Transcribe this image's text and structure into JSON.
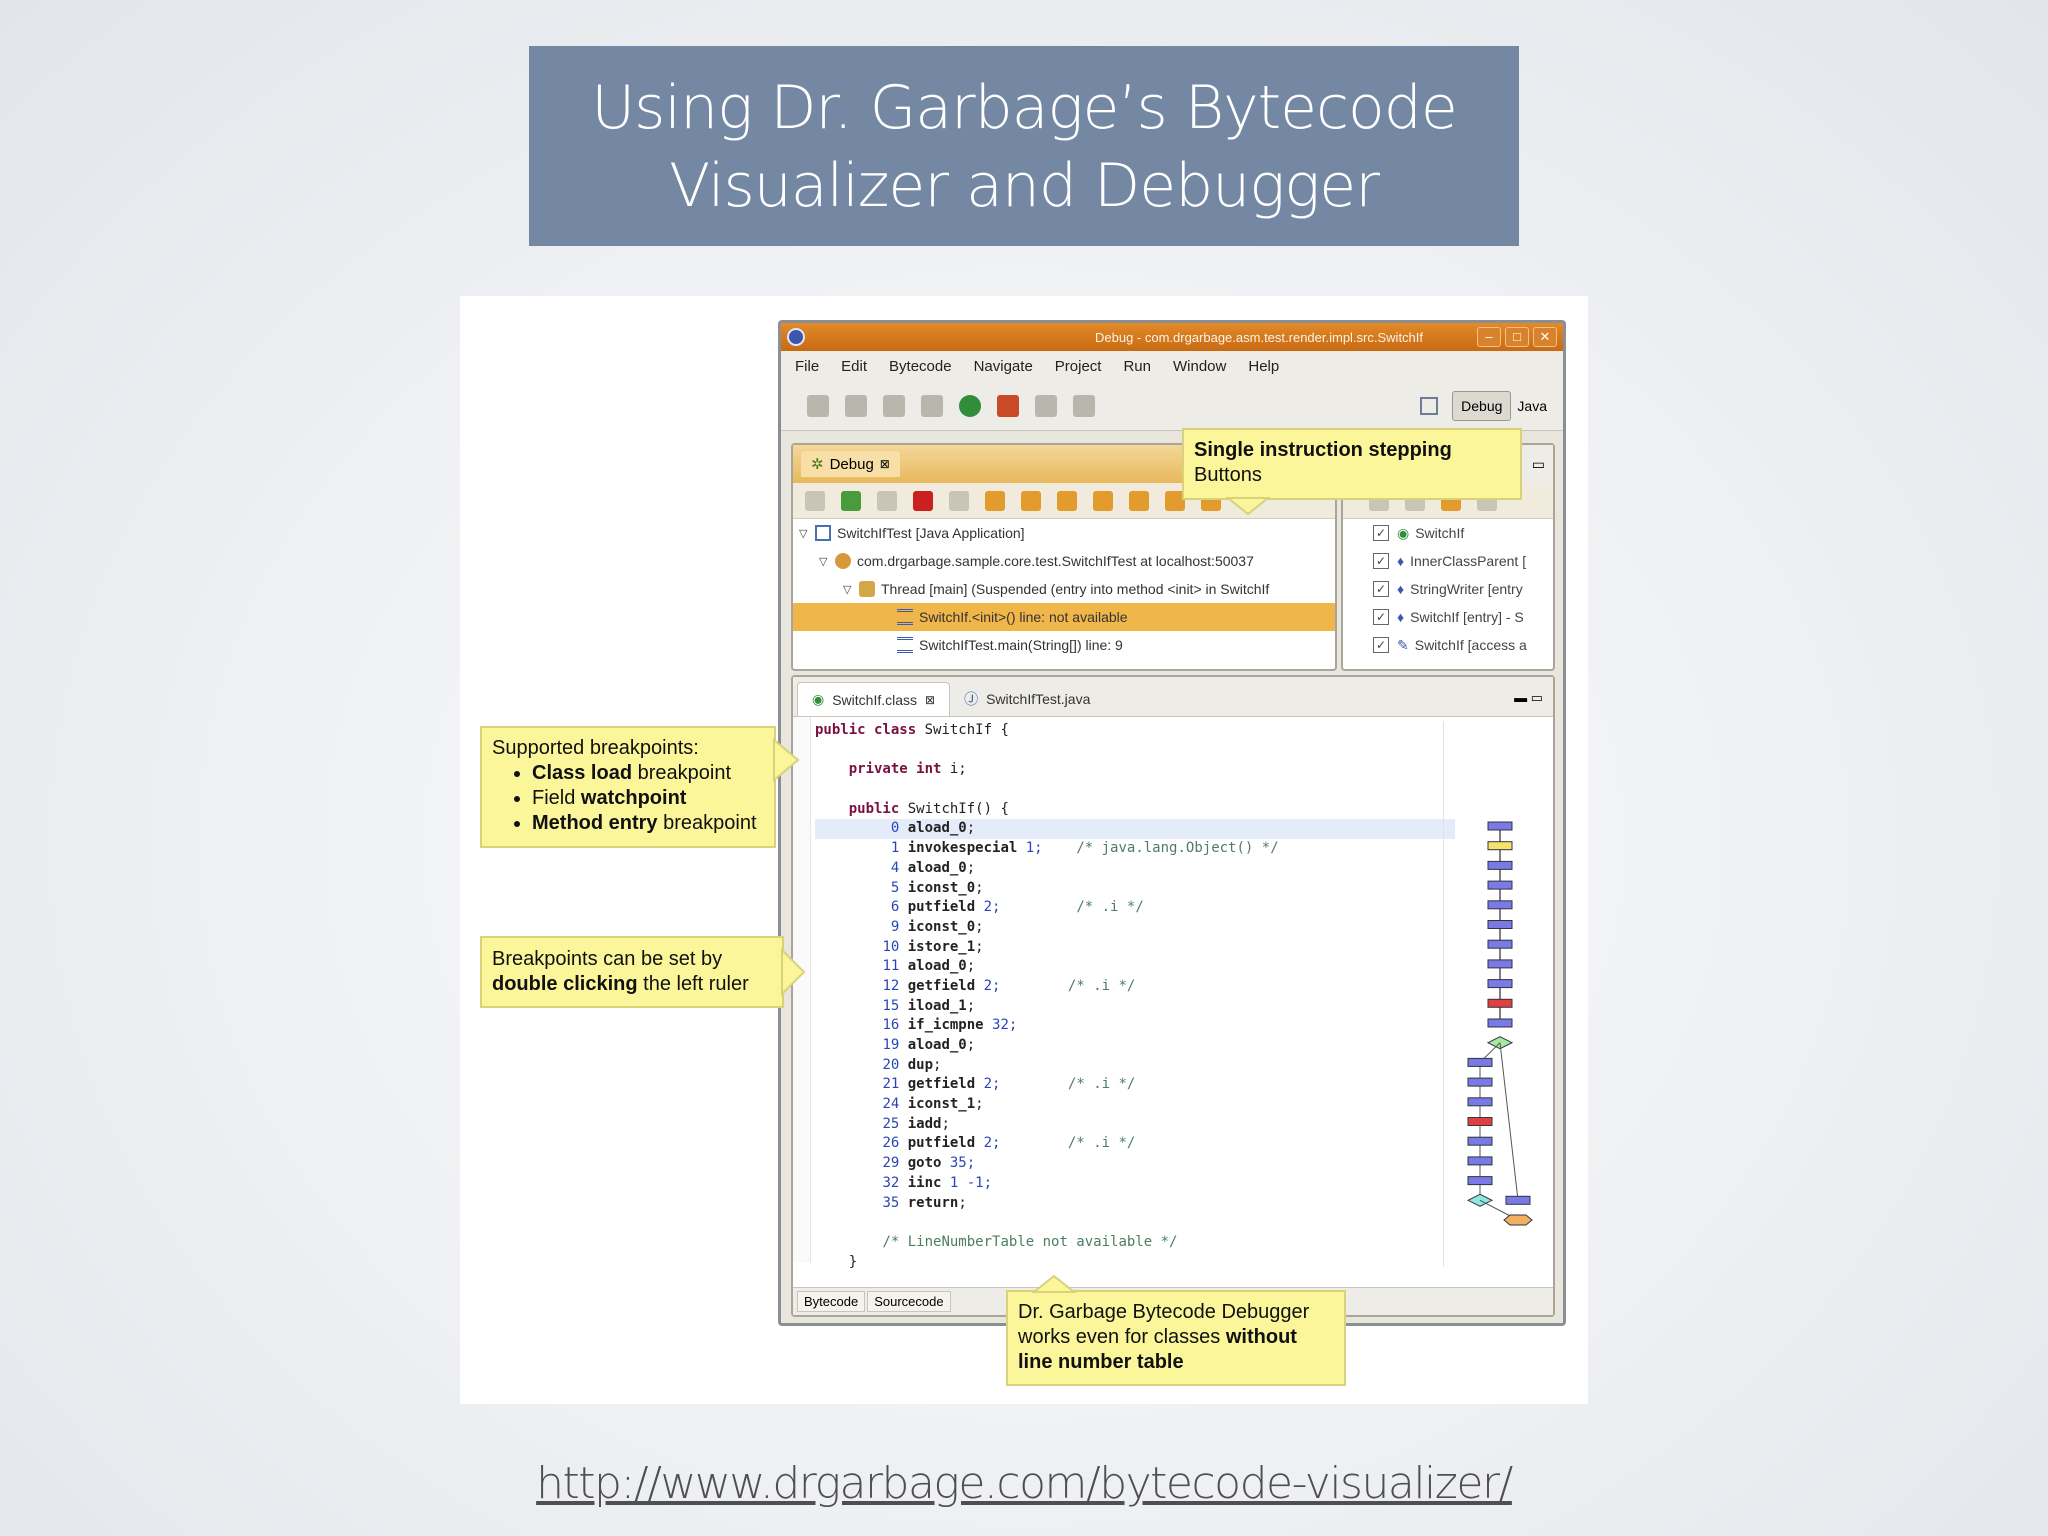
{
  "slide": {
    "title_line1": "Using Dr. Garbage’s Bytecode",
    "title_line2": "Visualizer and Debugger",
    "url": "http://www.drgarbage.com/bytecode-visualizer/",
    "title_bg": "#7488a4"
  },
  "window": {
    "title": "Debug - com.drgarbage.asm.test.render.impl.src.SwitchIf",
    "menu": [
      "File",
      "Edit",
      "Bytecode",
      "Navigate",
      "Project",
      "Run",
      "Window",
      "Help"
    ],
    "perspectives": {
      "debug": "Debug",
      "java": "Java"
    }
  },
  "debug_view": {
    "tab_label": "Debug",
    "tree": [
      "SwitchIfTest [Java Application]",
      "com.drgarbage.sample.core.test.SwitchIfTest at localhost:50037",
      "Thread [main] (Suspended (entry into method <init> in SwitchIf",
      "SwitchIf.<init>() line: not available",
      "SwitchIfTest.main(String[]) line: 9"
    ]
  },
  "breakpoints_view": {
    "rows": [
      "SwitchIf",
      "InnerClassParent [",
      "StringWriter [entry",
      "SwitchIf [entry] - S",
      "SwitchIf [access a"
    ]
  },
  "editor": {
    "tabs": [
      "SwitchIf.class",
      "SwitchIfTest.java"
    ],
    "bottom_tabs": [
      "Bytecode",
      "Sourcecode"
    ],
    "code": [
      {
        "ln": "",
        "kw": "public class",
        "rest": " SwitchIf {",
        "cm": "",
        "indent": 0
      },
      {
        "ln": "",
        "kw": "",
        "rest": "",
        "cm": "",
        "indent": 0
      },
      {
        "ln": "",
        "kw": "private int",
        "rest": " i;",
        "cm": "",
        "indent": 4
      },
      {
        "ln": "",
        "kw": "",
        "rest": "",
        "cm": "",
        "indent": 0
      },
      {
        "ln": "",
        "kw": "public",
        "rest": " SwitchIf() {",
        "cm": "",
        "indent": 4
      },
      {
        "ln": "0",
        "op": "aload_0",
        "rest": ";",
        "cm": "",
        "indent": 8,
        "hl": true
      },
      {
        "ln": "1",
        "op": "invokespecial",
        "rest": " 1;",
        "cm": "/* java.lang.Object() */",
        "indent": 8
      },
      {
        "ln": "4",
        "op": "aload_0",
        "rest": ";",
        "cm": "",
        "indent": 8
      },
      {
        "ln": "5",
        "op": "iconst_0",
        "rest": ";",
        "cm": "",
        "indent": 8
      },
      {
        "ln": "6",
        "op": "putfield",
        "rest": " 2;",
        "cm": "/* .i */",
        "indent": 8
      },
      {
        "ln": "9",
        "op": "iconst_0",
        "rest": ";",
        "cm": "",
        "indent": 8
      },
      {
        "ln": "10",
        "op": "istore_1",
        "rest": ";",
        "cm": "",
        "indent": 8
      },
      {
        "ln": "11",
        "op": "aload_0",
        "rest": ";",
        "cm": "",
        "indent": 8
      },
      {
        "ln": "12",
        "op": "getfield",
        "rest": " 2;",
        "cm": "/* .i */",
        "indent": 8
      },
      {
        "ln": "15",
        "op": "iload_1",
        "rest": ";",
        "cm": "",
        "indent": 8
      },
      {
        "ln": "16",
        "op": "if_icmpne",
        "rest": " 32;",
        "cm": "",
        "indent": 8
      },
      {
        "ln": "19",
        "op": "aload_0",
        "rest": ";",
        "cm": "",
        "indent": 8
      },
      {
        "ln": "20",
        "op": "dup",
        "rest": ";",
        "cm": "",
        "indent": 8
      },
      {
        "ln": "21",
        "op": "getfield",
        "rest": " 2;",
        "cm": "/* .i */",
        "indent": 8
      },
      {
        "ln": "24",
        "op": "iconst_1",
        "rest": ";",
        "cm": "",
        "indent": 8
      },
      {
        "ln": "25",
        "op": "iadd",
        "rest": ";",
        "cm": "",
        "indent": 8
      },
      {
        "ln": "26",
        "op": "putfield",
        "rest": " 2;",
        "cm": "/* .i */",
        "indent": 8
      },
      {
        "ln": "29",
        "op": "goto",
        "rest": " 35;",
        "cm": "",
        "indent": 8
      },
      {
        "ln": "32",
        "op": "iinc",
        "rest": " 1 -1;",
        "cm": "",
        "indent": 8
      },
      {
        "ln": "35",
        "op": "return",
        "rest": ";",
        "cm": "",
        "indent": 8
      },
      {
        "ln": "",
        "kw": "",
        "rest": "",
        "cm": "",
        "indent": 0
      },
      {
        "ln": "",
        "kw": "",
        "rest": "",
        "cm": "/* LineNumberTable not available */",
        "indent": 8
      },
      {
        "ln": "",
        "kw": "",
        "rest": "}",
        "cm": "",
        "indent": 4
      }
    ]
  },
  "callouts": {
    "stepping": {
      "line1": "Single instruction stepping",
      "line2": "Buttons"
    },
    "breakpoints": {
      "heading": "Supported breakpoints:",
      "items": [
        {
          "bold": "Class load",
          "rest": " breakpoint"
        },
        {
          "plain": "Field ",
          "bold": "watchpoint"
        },
        {
          "bold": "Method entry",
          "rest": " breakpoint"
        }
      ]
    },
    "ruler": {
      "line1": "Breakpoints can be set by",
      "bold": "double clicking",
      "rest": " the left ruler"
    },
    "linenum": {
      "line1": "Dr. Garbage Bytecode Debugger",
      "line2a": "works even for classes ",
      "line2b": "without",
      "line3": "line number table"
    }
  }
}
